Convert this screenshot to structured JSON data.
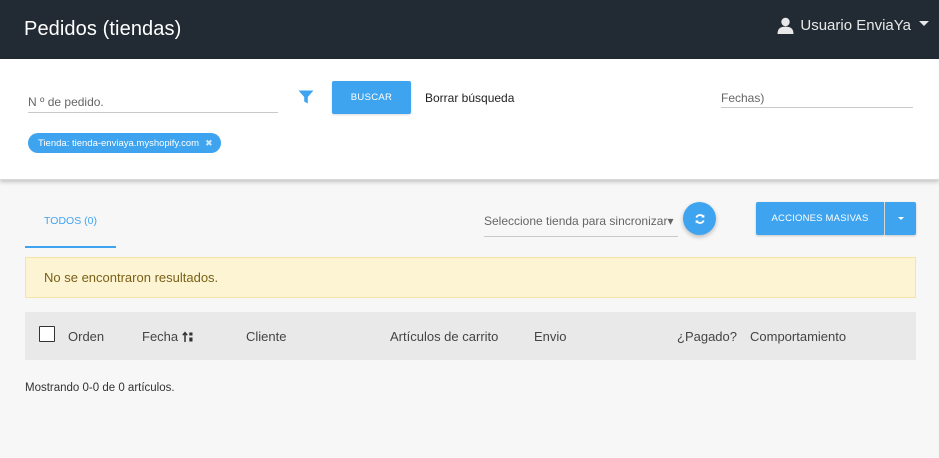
{
  "header": {
    "title": "Pedidos (tiendas)",
    "user_name": "Usuario EnviaYa"
  },
  "search": {
    "order_placeholder": "N º de pedido.",
    "search_button": "BUSCAR",
    "clear_link": "Borrar búsqueda",
    "dates_placeholder": "Fechas)",
    "chip_label": "Tienda: tienda-enviaya.myshopify.com"
  },
  "toolbar": {
    "tab_label": "TODOS (0)",
    "store_select": "Seleccione tienda para sincronizar",
    "mass_actions_label": "ACCIONES MASIVAS"
  },
  "alert": {
    "message": "No se encontraron resultados."
  },
  "table": {
    "columns": [
      "Orden",
      "Fecha",
      "Cliente",
      "Artículos de carrito",
      "Envio",
      "¿Pagado?",
      "Comportamiento"
    ]
  },
  "footer": {
    "summary": "Mostrando 0-0 de 0 artículos."
  },
  "colors": {
    "accent": "#3fa4f0",
    "topbar": "#222a33",
    "alert_bg": "#fcf4d2"
  }
}
